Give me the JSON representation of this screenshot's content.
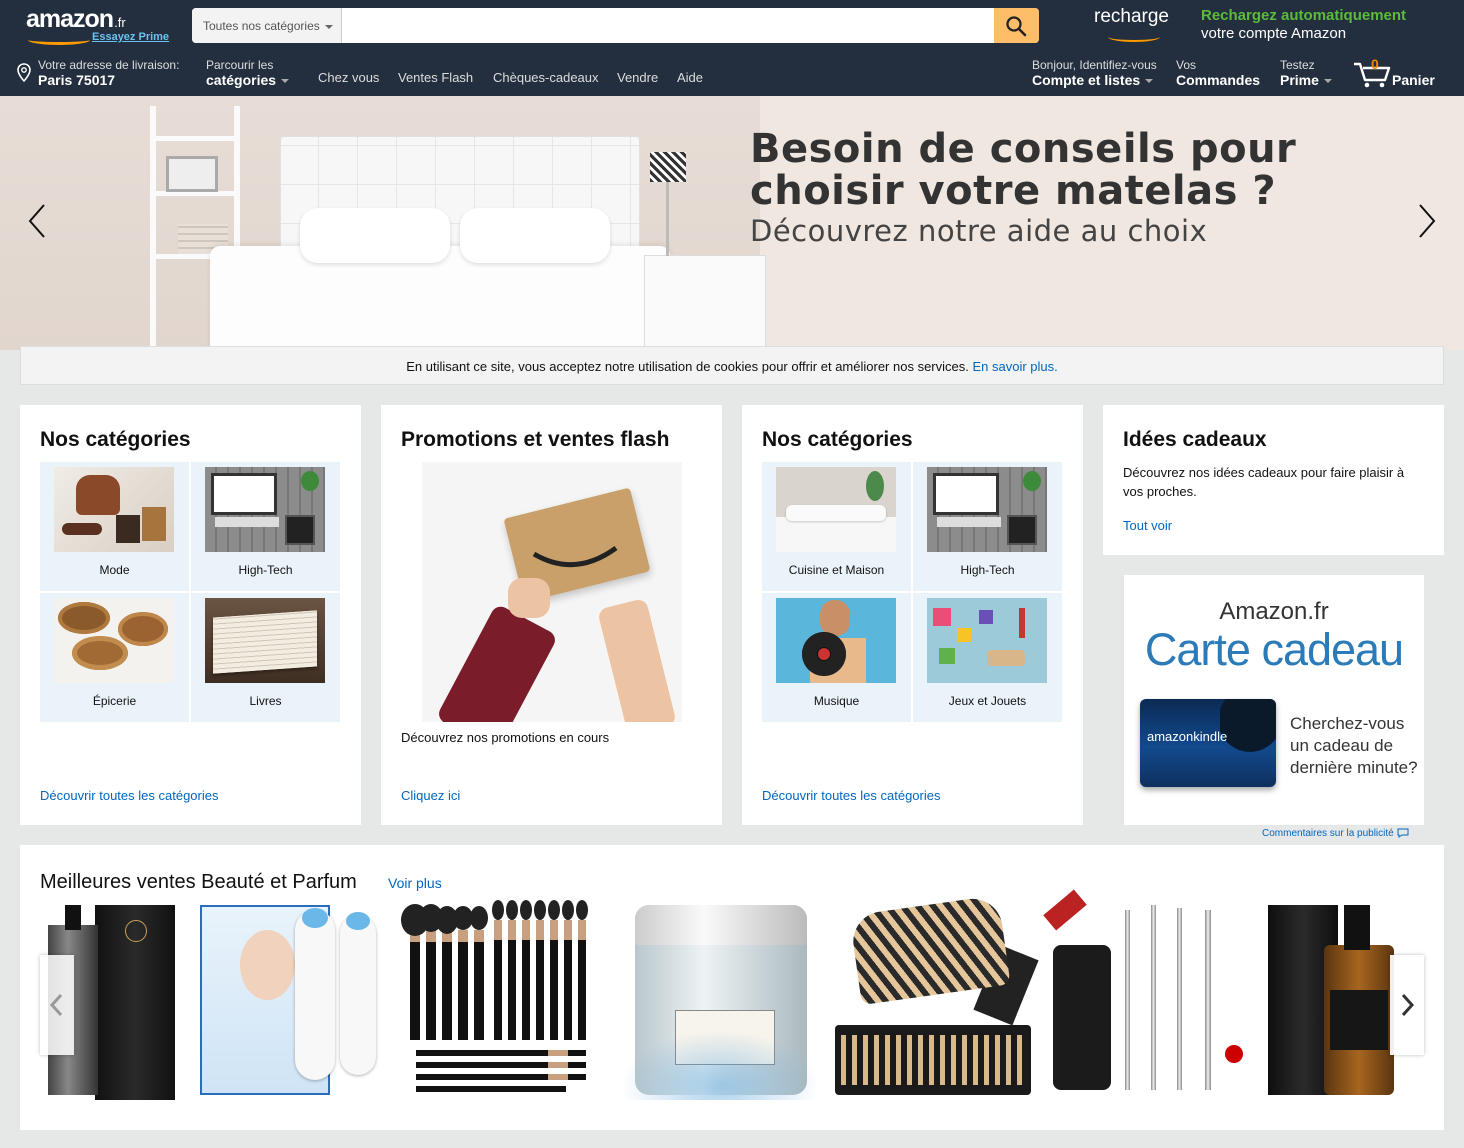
{
  "header": {
    "logo_text": "amazon",
    "logo_tld": ".fr",
    "prime_cta": "Essayez Prime",
    "search": {
      "category": "Toutes nos catégories",
      "placeholder": "",
      "value": ""
    },
    "recharge": {
      "brand": "recharge",
      "promo_line1": "Rechargez automatiquement",
      "promo_line2": "votre compte Amazon"
    },
    "delivery": {
      "label": "Votre adresse de livraison:",
      "address": "Paris 75017"
    },
    "browse": {
      "label": "Parcourir les",
      "value": "catégories"
    },
    "nav_links": [
      "Chez vous",
      "Ventes Flash",
      "Chèques-cadeaux",
      "Vendre",
      "Aide"
    ],
    "account": {
      "label": "Bonjour, Identifiez-vous",
      "value": "Compte et listes"
    },
    "orders": {
      "label": "Vos",
      "value": "Commandes"
    },
    "prime": {
      "label": "Testez",
      "value": "Prime"
    },
    "cart": {
      "count": "0",
      "label": "Panier"
    },
    "colors": {
      "nav_bg": "#232f3e",
      "accent": "#febd69",
      "orange": "#f90",
      "green": "#5bbb3b"
    }
  },
  "hero": {
    "title_line1": "Besoin de conseils pour",
    "title_line2": "choisir votre matelas ?",
    "subtitle": "Découvrez notre aide au choix"
  },
  "cookie_bar": {
    "text": "En utilisant ce site, vous acceptez notre utilisation de cookies pour offrir et améliorer nos services.",
    "link": "En savoir plus."
  },
  "cards": {
    "categories1": {
      "title": "Nos catégories",
      "tiles": [
        "Mode",
        "High-Tech",
        "Épicerie",
        "Livres"
      ],
      "link": "Découvrir toutes les catégories"
    },
    "promos": {
      "title": "Promotions et ventes flash",
      "caption": "Découvrez nos promotions en cours",
      "link": "Cliquez ici"
    },
    "categories2": {
      "title": "Nos catégories",
      "tiles": [
        "Cuisine et Maison",
        "High-Tech",
        "Musique",
        "Jeux et Jouets"
      ],
      "link": "Découvrir toutes les catégories"
    },
    "ideas": {
      "title": "Idées cadeaux",
      "text": "Découvrez nos idées cadeaux pour faire plaisir à vos proches.",
      "link": "Tout voir"
    }
  },
  "ad": {
    "line1": "Amazon.fr",
    "line2": "Carte cadeau",
    "card_brand": "amazon",
    "card_brand2": "kindle",
    "question": "Cherchez-vous un cadeau de dernière minute?",
    "feedback": "Commentaires sur la publicité"
  },
  "best_sellers": {
    "title": "Meilleures ventes Beauté et Parfum",
    "more": "Voir plus",
    "products": [
      "bio-hyaluronic-serum",
      "blackhead-remover",
      "makeup-brush-set",
      "retinol-moisturizer",
      "brush-set-with-case",
      "blackhead-extractor-kit",
      "beard-oil"
    ]
  }
}
